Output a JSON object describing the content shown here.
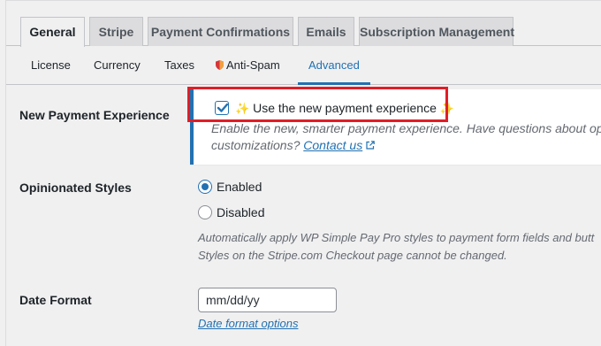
{
  "tabs": [
    {
      "label": "General",
      "active": true
    },
    {
      "label": "Stripe",
      "active": false
    },
    {
      "label": "Payment Confirmations",
      "active": false
    },
    {
      "label": "Emails",
      "active": false
    },
    {
      "label": "Subscription Management",
      "active": false
    }
  ],
  "subtabs": [
    {
      "label": "License"
    },
    {
      "label": "Currency"
    },
    {
      "label": "Taxes"
    },
    {
      "label": "Anti-Spam",
      "icon": "shield-icon"
    },
    {
      "label": "Advanced",
      "active": true
    }
  ],
  "new_payment": {
    "label": "New Payment Experience",
    "checkbox_label": "Use the new payment experience",
    "sparkle": "✨",
    "checked": true,
    "desc_line1": "Enable the new, smarter payment experience. Have questions about opting i",
    "desc_line2_prefix": "customizations?",
    "contact_link": "Contact us"
  },
  "opinionated": {
    "label": "Opinionated Styles",
    "options": [
      "Enabled",
      "Disabled"
    ],
    "selected": "Enabled",
    "desc_line1": "Automatically apply WP Simple Pay Pro styles to payment form fields and butt",
    "desc_line2": "Styles on the Stripe.com Checkout page cannot be changed."
  },
  "date_format": {
    "label": "Date Format",
    "value": "mm/dd/yy",
    "link": "Date format options"
  },
  "colors": {
    "accent": "#2271b1",
    "highlight": "#e01e26",
    "background": "#f0f0f1"
  }
}
